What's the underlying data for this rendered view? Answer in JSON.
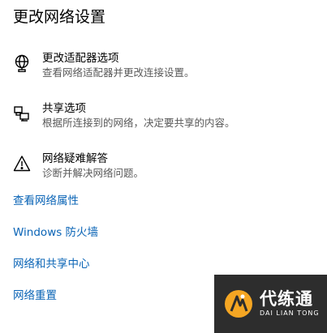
{
  "page": {
    "title": "更改网络设置"
  },
  "options": [
    {
      "icon": "adapter-icon",
      "title": "更改适配器选项",
      "desc": "查看网络适配器并更改连接设置。"
    },
    {
      "icon": "sharing-icon",
      "title": "共享选项",
      "desc": "根据所连接到的网络，决定要共享的内容。"
    },
    {
      "icon": "warning-icon",
      "title": "网络疑难解答",
      "desc": "诊断并解决网络问题。"
    }
  ],
  "links": [
    "查看网络属性",
    "Windows 防火墙",
    "网络和共享中心",
    "网络重置"
  ],
  "watermark": {
    "icon": "logo-icon",
    "name": "代练通",
    "sub": "DAI LIAN TONG"
  },
  "colors": {
    "link": "#0a64b6",
    "desc": "#595959",
    "watermark_bg": "#2d2d2d",
    "logo_orange": "#f5a623"
  }
}
